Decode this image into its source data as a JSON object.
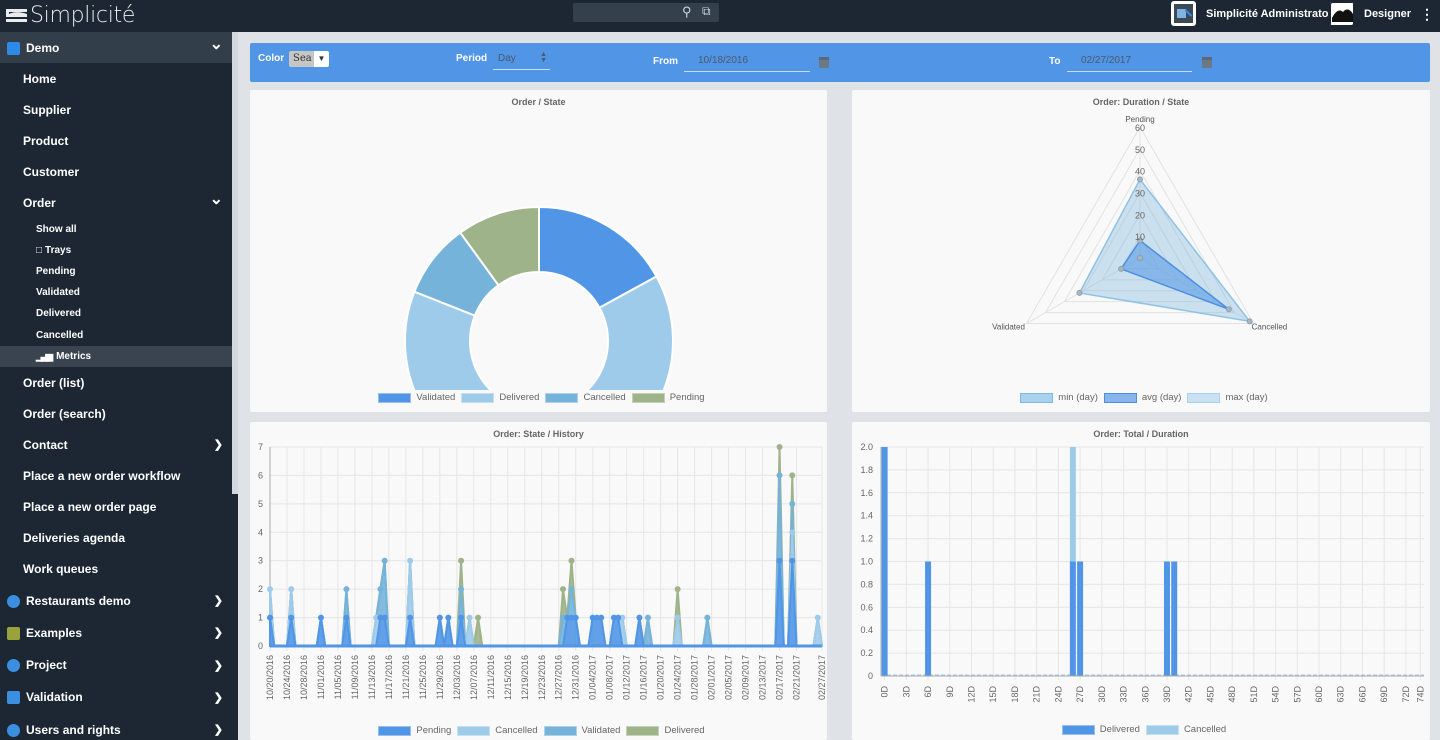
{
  "app": {
    "title": "Simplicité",
    "users": [
      {
        "name": "Simplicité Administrator"
      },
      {
        "name": "Designer"
      }
    ],
    "search_icon": "search-icon",
    "external_icon": "external-link-icon",
    "menu_icon": "kebab-menu-icon"
  },
  "sidebar": {
    "items": [
      {
        "label": "Demo",
        "level": 0,
        "icon": "demo-module-icon",
        "chevron": "down",
        "top": true
      },
      {
        "label": "Home",
        "level": 1
      },
      {
        "label": "Supplier",
        "level": 1
      },
      {
        "label": "Product",
        "level": 1
      },
      {
        "label": "Customer",
        "level": 1
      },
      {
        "label": "Order",
        "level": 1,
        "chevron": "down"
      },
      {
        "label": "Show all",
        "level": 2
      },
      {
        "label": "Trays",
        "level": 2,
        "icon": "trays-icon"
      },
      {
        "label": "Pending",
        "level": 2
      },
      {
        "label": "Validated",
        "level": 2
      },
      {
        "label": "Delivered",
        "level": 2
      },
      {
        "label": "Cancelled",
        "level": 2
      },
      {
        "label": "Metrics",
        "level": 2,
        "icon": "bar-chart-icon",
        "active": true
      },
      {
        "label": "Order (list)",
        "level": 1
      },
      {
        "label": "Order (search)",
        "level": 1
      },
      {
        "label": "Contact",
        "level": 1,
        "chevron": "right"
      },
      {
        "label": "Place a new order workflow",
        "level": 1
      },
      {
        "label": "Place a new order page",
        "level": 1
      },
      {
        "label": "Deliveries agenda",
        "level": 1
      },
      {
        "label": "Work queues",
        "level": 1
      },
      {
        "label": "Restaurants demo",
        "level": 0,
        "icon": "restaurant-icon",
        "chevron": "right"
      },
      {
        "label": "Examples",
        "level": 0,
        "icon": "cone-icon",
        "chevron": "right"
      },
      {
        "label": "Project",
        "level": 0,
        "icon": "bulb-icon",
        "chevron": "right"
      },
      {
        "label": "Validation",
        "level": 0,
        "icon": "flask-icon",
        "chevron": "right"
      },
      {
        "label": "Users and rights",
        "level": 0,
        "icon": "user-icon",
        "chevron": "right"
      }
    ]
  },
  "filters": {
    "color_label": "Color",
    "color_value": "Sea",
    "period_label": "Period",
    "period_value": "Day",
    "from_label": "From",
    "from_value": "10/18/2016",
    "to_label": "To",
    "to_value": "02/27/2017"
  },
  "colors": {
    "accent": "#5196e6",
    "validated": "#5196e6",
    "delivered": "#9fcbea",
    "cancelled": "#75b3da",
    "pending": "#9fb38a"
  },
  "chart_data": [
    {
      "type": "pie",
      "title": "Order / State",
      "doughnut": true,
      "categories": [
        "Validated",
        "Delivered",
        "Cancelled",
        "Pending"
      ],
      "values": [
        17,
        64,
        9,
        10
      ],
      "legend": "bottom"
    },
    {
      "type": "radar",
      "title": "Order: Duration / State",
      "axes": [
        "Pending",
        "Cancelled",
        "Validated"
      ],
      "rlim": [
        0,
        60
      ],
      "ticks": [
        10,
        20,
        30,
        40,
        50,
        60
      ],
      "series": [
        {
          "name": "min (day)",
          "values": [
            0,
            0,
            0
          ]
        },
        {
          "name": "avg (day)",
          "values": [
            8,
            47,
            10
          ]
        },
        {
          "name": "max (day)",
          "values": [
            36,
            58,
            32
          ]
        }
      ],
      "legend": "bottom"
    },
    {
      "type": "area",
      "title": "Order: State / History",
      "stacked": true,
      "ylim": [
        0,
        7
      ],
      "yticks": [
        0,
        1,
        2,
        3,
        4,
        5,
        6,
        7
      ],
      "xticks": [
        "10/20/2016",
        "10/24/2016",
        "10/28/2016",
        "11/01/2016",
        "11/05/2016",
        "11/09/2016",
        "11/13/2016",
        "11/17/2016",
        "11/21/2016",
        "11/25/2016",
        "11/29/2016",
        "12/03/2016",
        "12/07/2016",
        "12/11/2016",
        "12/15/2016",
        "12/19/2016",
        "12/23/2016",
        "12/27/2016",
        "12/31/2016",
        "01/04/2017",
        "01/08/2017",
        "01/12/2017",
        "01/16/2017",
        "01/20/2017",
        "01/24/2017",
        "01/28/2017",
        "02/01/2017",
        "02/05/2017",
        "02/09/2017",
        "02/13/2017",
        "02/17/2017",
        "02/21/2017",
        "02/27/2017"
      ],
      "x_start": "10/20/2016",
      "n_days": 131,
      "series": [
        {
          "name": "Pending",
          "points": [
            [
              0,
              1
            ],
            [
              5,
              1
            ],
            [
              12,
              1
            ],
            [
              18,
              1
            ],
            [
              26,
              1
            ],
            [
              27,
              1
            ],
            [
              33,
              1
            ],
            [
              40,
              1
            ],
            [
              42,
              1
            ],
            [
              45,
              1
            ],
            [
              70,
              1
            ],
            [
              71,
              1
            ],
            [
              72,
              1
            ],
            [
              76,
              1
            ],
            [
              77,
              1
            ],
            [
              78,
              1
            ],
            [
              81,
              1
            ],
            [
              82,
              1
            ],
            [
              87,
              1
            ],
            [
              120,
              3
            ],
            [
              123,
              3
            ]
          ]
        },
        {
          "name": "Cancelled",
          "points": [
            [
              0,
              1
            ],
            [
              5,
              1
            ],
            [
              25,
              1
            ],
            [
              33,
              2
            ],
            [
              47,
              1
            ],
            [
              83,
              1
            ],
            [
              96,
              1
            ],
            [
              123,
              1
            ],
            [
              129,
              1
            ]
          ]
        },
        {
          "name": "Validated",
          "points": [
            [
              18,
              1
            ],
            [
              26,
              1
            ],
            [
              27,
              2
            ],
            [
              45,
              1
            ],
            [
              69,
              1
            ],
            [
              71,
              1
            ],
            [
              89,
              1
            ],
            [
              103,
              1
            ],
            [
              120,
              3
            ],
            [
              123,
              1
            ]
          ]
        },
        {
          "name": "Delivered",
          "points": [
            [
              45,
              1
            ],
            [
              49,
              1
            ],
            [
              69,
              1
            ],
            [
              71,
              1
            ],
            [
              96,
              1
            ],
            [
              120,
              1
            ],
            [
              123,
              1
            ]
          ]
        }
      ],
      "legend": "bottom"
    },
    {
      "type": "bar",
      "title": "Order: Total / Duration",
      "stacked": true,
      "ylim": [
        0,
        2.0
      ],
      "yticks": [
        "0",
        "0.2",
        "0.4",
        "0.6",
        "0.8",
        "1.0",
        "1.2",
        "1.4",
        "1.6",
        "1.8",
        "2.0"
      ],
      "xticks": [
        "0D",
        "3D",
        "6D",
        "9D",
        "12D",
        "15D",
        "18D",
        "21D",
        "24D",
        "27D",
        "30D",
        "33D",
        "36D",
        "39D",
        "42D",
        "45D",
        "48D",
        "51D",
        "54D",
        "57D",
        "60D",
        "63D",
        "66D",
        "69D",
        "72D",
        "74D"
      ],
      "x_range": [
        0,
        74
      ],
      "series": [
        {
          "name": "Delivered",
          "points": [
            [
              0,
              2
            ],
            [
              6,
              1
            ],
            [
              26,
              1
            ],
            [
              27,
              1
            ],
            [
              39,
              1
            ],
            [
              40,
              1
            ]
          ]
        },
        {
          "name": "Cancelled",
          "points": [
            [
              26,
              1
            ]
          ]
        }
      ],
      "legend": "bottom"
    }
  ]
}
